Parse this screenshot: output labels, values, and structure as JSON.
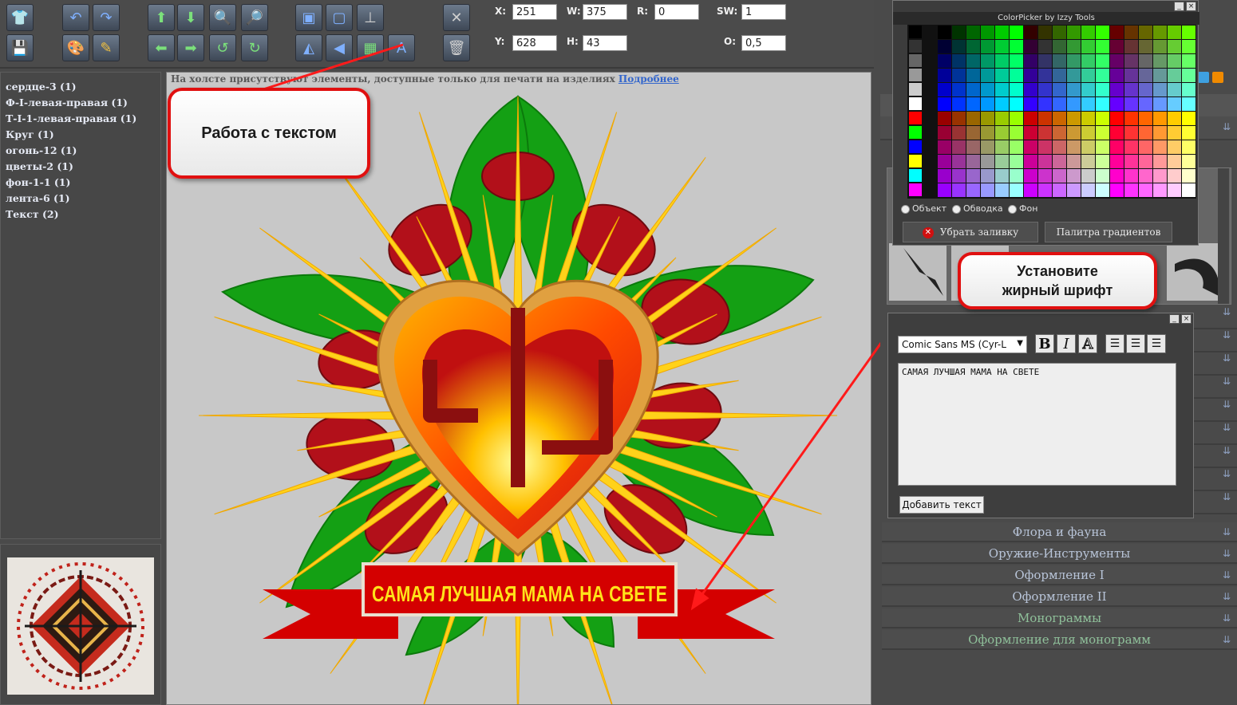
{
  "toolbar": {
    "fields": {
      "x": {
        "label": "X:",
        "value": "251"
      },
      "y": {
        "label": "Y:",
        "value": "628"
      },
      "w": {
        "label": "W:",
        "value": "375"
      },
      "h": {
        "label": "H:",
        "value": "43"
      },
      "r": {
        "label": "R:",
        "value": "0"
      },
      "sw": {
        "label": "SW:",
        "value": "1"
      },
      "o": {
        "label": "O:",
        "value": "0,5"
      }
    }
  },
  "layers": [
    "сердце-3 (1)",
    "Ф-I-левая-правая (1)",
    "Т-I-1-левая-правая (1)",
    "Круг (1)",
    "огонь-12 (1)",
    "цветы-2 (1)",
    "фон-1-1 (1)",
    "лента-6 (1)",
    "Текст (2)"
  ],
  "canvas": {
    "notice_text": "На холсте присутствуют элементы, доступные только для печати на изделиях",
    "notice_link": "Подробнее",
    "banner_text": "САМАЯ ЛУЧШАЯ МАМА НА СВЕТЕ"
  },
  "callouts": {
    "text_work": "Работа с текстом",
    "bold_line1": "Установите",
    "bold_line2": "жирный шрифт"
  },
  "color_picker": {
    "title": "ColorPicker by Izzy Tools",
    "radio_object": "Объект",
    "radio_stroke": "Обводка",
    "radio_bg": "Фон",
    "remove_fill": "Убрать заливку",
    "gradient_palette": "Палитра градиентов"
  },
  "text_editor": {
    "font": "Comic Sans MS (Cyr-L",
    "bold": "B",
    "italic": "I",
    "outline": "A",
    "content": "САМАЯ ЛУЧШАЯ МАМА НА СВЕТЕ",
    "add_button": "Добавить текст"
  },
  "categories": [
    "Флора и фауна",
    "Оружие-Инструменты",
    "Оформление I",
    "Оформление II",
    "Монограммы",
    "Оформление для монограмм"
  ],
  "colors": {
    "callout_border": "#e01010",
    "banner_red": "#d40000",
    "banner_text": "#ffe21a",
    "leaf_green": "#19a319",
    "ray_yellow": "#ffd21a"
  }
}
